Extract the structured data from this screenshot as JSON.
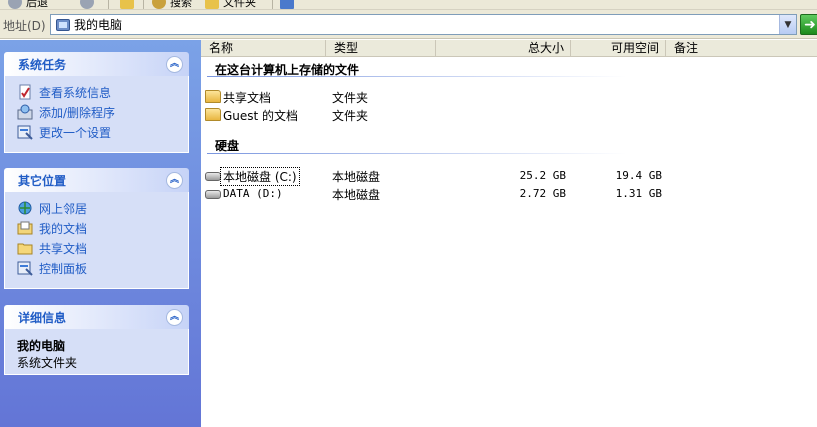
{
  "toolbar": {
    "items": [
      "后退",
      "",
      "搜索",
      "文件夹"
    ]
  },
  "address": {
    "label": "地址(D)",
    "value": "我的电脑",
    "go_icon": "arrow-right-icon"
  },
  "left_pane": {
    "system_tasks": {
      "title": "系统任务",
      "items": [
        {
          "label": "查看系统信息",
          "icon": "system-info-icon"
        },
        {
          "label": "添加/删除程序",
          "icon": "add-remove-programs-icon"
        },
        {
          "label": "更改一个设置",
          "icon": "control-panel-icon"
        }
      ]
    },
    "other_places": {
      "title": "其它位置",
      "items": [
        {
          "label": "网上邻居",
          "icon": "network-icon"
        },
        {
          "label": "我的文档",
          "icon": "my-documents-icon"
        },
        {
          "label": "共享文档",
          "icon": "shared-folder-icon"
        },
        {
          "label": "控制面板",
          "icon": "control-panel-icon"
        }
      ]
    },
    "details": {
      "title": "详细信息",
      "name": "我的电脑",
      "type": "系统文件夹"
    }
  },
  "columns": {
    "name": "名称",
    "type": "类型",
    "total_size": "总大小",
    "free_space": "可用空间",
    "comment": "备注"
  },
  "groups": {
    "stored_files": {
      "title": "在这台计算机上存储的文件",
      "items": [
        {
          "name": "共享文档",
          "type": "文件夹"
        },
        {
          "name": "Guest 的文档",
          "type": "文件夹"
        }
      ]
    },
    "hard_disks": {
      "title": "硬盘",
      "items": [
        {
          "name": "本地磁盘 (C:)",
          "type": "本地磁盘",
          "total": "25.2 GB",
          "free": "19.4 GB"
        },
        {
          "name": "DATA (D:)",
          "type": "本地磁盘",
          "total": "2.72 GB",
          "free": "1.31 GB"
        }
      ]
    }
  }
}
